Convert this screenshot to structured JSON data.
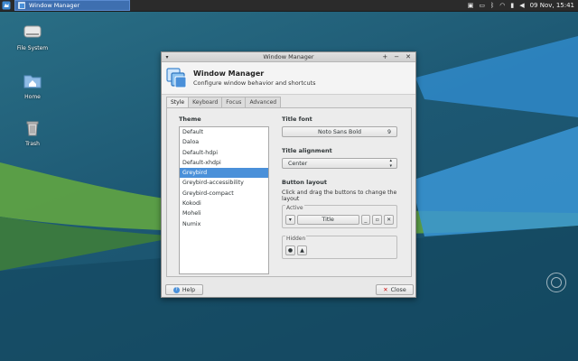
{
  "taskbar": {
    "window_button_label": "Window Manager",
    "clock": "09 Nov, 15:41"
  },
  "desktop_icons": [
    {
      "label": "File System"
    },
    {
      "label": "Home"
    },
    {
      "label": "Trash"
    }
  ],
  "window": {
    "title": "Window Manager",
    "menu_glyph": "▾",
    "ctrl_maximize": "+",
    "ctrl_minimize": "−",
    "ctrl_close": "✕",
    "header_title": "Window Manager",
    "header_subtitle": "Configure window behavior and shortcuts",
    "tabs": [
      {
        "label": "Style"
      },
      {
        "label": "Keyboard"
      },
      {
        "label": "Focus"
      },
      {
        "label": "Advanced"
      }
    ],
    "theme_label": "Theme",
    "themes": [
      "Default",
      "Daloa",
      "Default-hdpi",
      "Default-xhdpi",
      "Greybird",
      "Greybird-accessibility",
      "Greybird-compact",
      "Kokodi",
      "Moheli",
      "Numix"
    ],
    "selected_theme": "Greybird",
    "title_font_label": "Title font",
    "title_font_value": "Noto Sans Bold",
    "title_font_size": "9",
    "title_alignment_label": "Title alignment",
    "title_alignment_value": "Center",
    "button_layout_label": "Button layout",
    "button_layout_hint": "Click and drag the buttons to change the layout",
    "active_label": "Active",
    "active_title_button": "Title",
    "hidden_label": "Hidden",
    "help_label": "Help",
    "close_label": "Close"
  },
  "colors": {
    "selection": "#4a90d9",
    "taskbar": "#2b2b2b",
    "task_active": "#3e6fb0",
    "desktop_green": "#5ea144",
    "desktop_blue": "#2b7bb5"
  }
}
